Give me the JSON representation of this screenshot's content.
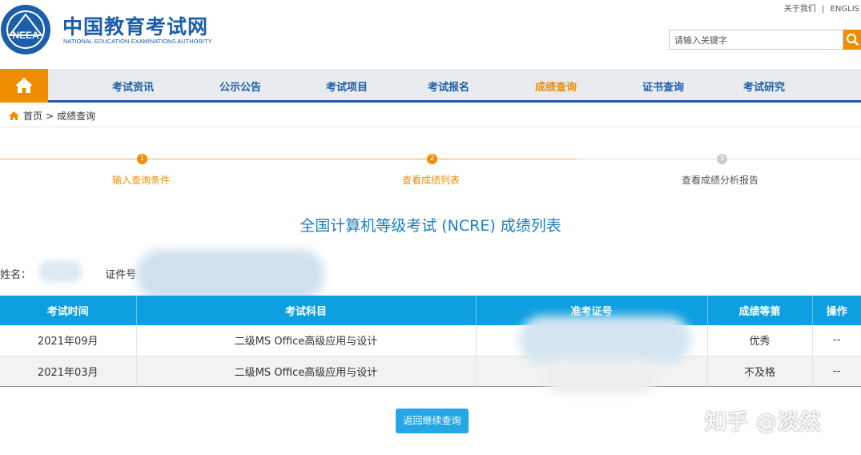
{
  "header": {
    "logo_text": "NEEA",
    "title": "中国教育考试网",
    "subtitle": "NATIONAL EDUCATION EXAMINATIONS AUTHORITY",
    "top_links": [
      "关于我们",
      "|",
      "ENGLIS"
    ],
    "search_placeholder": "请输入关键字"
  },
  "nav": {
    "items": [
      "考试资讯",
      "公示公告",
      "考试项目",
      "考试报名",
      "成绩查询",
      "证书查询",
      "考试研究"
    ],
    "active": "成绩查询"
  },
  "breadcrumb": {
    "home": "首页",
    "separator": ">",
    "current": "成绩查询"
  },
  "steps": [
    {
      "num": "1",
      "label": "输入查询条件",
      "done": true
    },
    {
      "num": "2",
      "label": "查看成绩列表",
      "done": true
    },
    {
      "num": "3",
      "label": "查看成绩分析报告",
      "done": false
    }
  ],
  "list_title": "全国计算机等级考试 (NCRE) 成绩列表",
  "info": {
    "name_label": "姓名：",
    "id_label": "证件号"
  },
  "table": {
    "headers": [
      "考试时间",
      "考试科目",
      "准考证号",
      "成绩等第",
      "操作"
    ],
    "rows": [
      {
        "time": "2021年09月",
        "subject": "二级MS Office高级应用与设计",
        "ticket": "",
        "grade": "优秀",
        "action": "--"
      },
      {
        "time": "2021年03月",
        "subject": "二级MS Office高级应用与设计",
        "ticket": "",
        "grade": "不及格",
        "action": "--"
      }
    ]
  },
  "back_button": "返回继续查询",
  "watermark": "知乎 @淡然",
  "colors": {
    "brand_blue": "#1c5ea8",
    "accent_orange": "#f08c00",
    "table_header": "#0e9fe0"
  }
}
